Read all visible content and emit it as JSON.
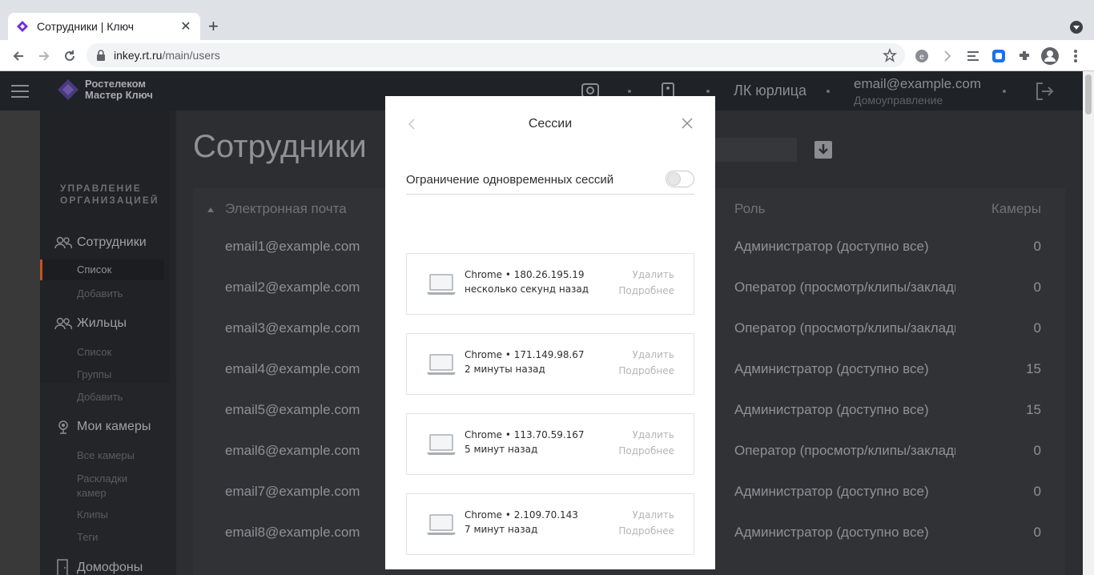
{
  "browser": {
    "tab_title": "Сотрудники | Ключ",
    "url_host": "inkey.rt.ru",
    "url_path": "/main/users"
  },
  "header": {
    "logo_line1": "Ростелеком",
    "logo_line2": "Мастер Ключ",
    "org_label": "ЛК юрлица",
    "user_email": "email@example.com",
    "user_sub": "Домоуправление"
  },
  "sidebar": {
    "section_title_1": "УПРАВЛЕНИЕ",
    "section_title_2": "ОРГАНИЗАЦИЕЙ",
    "employees": {
      "label": "Сотрудники",
      "list": "Список",
      "add": "Добавить"
    },
    "residents": {
      "label": "Жильцы",
      "list": "Список",
      "groups": "Группы",
      "add": "Добавить"
    },
    "cameras": {
      "label": "Мои камеры",
      "all": "Все камеры",
      "layouts_1": "Раскладки",
      "layouts_2": "камер",
      "clips": "Клипы",
      "tags": "Теги"
    },
    "intercoms": {
      "label": "Домофоны"
    }
  },
  "main": {
    "page_title": "Сотрудники",
    "columns": {
      "email": "Электронная почта",
      "role": "Роль",
      "cameras": "Камеры"
    },
    "rows": [
      {
        "email": "email1@example.com",
        "role": "Администратор (доступно все)",
        "cameras": "0"
      },
      {
        "email": "email2@example.com",
        "role": "Оператор (просмотр/клипы/закладки)",
        "cameras": "0"
      },
      {
        "email": "email3@example.com",
        "role": "Оператор (просмотр/клипы/закладки)",
        "cameras": "0"
      },
      {
        "email": "email4@example.com",
        "role": "Администратор (доступно все)",
        "cameras": "15"
      },
      {
        "email": "email5@example.com",
        "role": "Администратор (доступно все)",
        "cameras": "15"
      },
      {
        "email": "email6@example.com",
        "role": "Оператор (просмотр/клипы/закладки)",
        "cameras": "0"
      },
      {
        "email": "email7@example.com",
        "role": "Администратор (доступно все)",
        "cameras": "0"
      },
      {
        "email": "email8@example.com",
        "role": "Администратор (доступно все)",
        "cameras": "0"
      }
    ]
  },
  "modal": {
    "title": "Сессии",
    "limit_label": "Ограничение одновременных сессий",
    "limit_enabled": false,
    "delete_label": "Удалить",
    "details_label": "Подробнее",
    "sessions": [
      {
        "title": "Chrome • 180.26.195.19",
        "time": "несколько секунд назад"
      },
      {
        "title": "Chrome • 171.149.98.67",
        "time": "2 минуты назад"
      },
      {
        "title": "Chrome • 113.70.59.167",
        "time": "5 минут назад"
      },
      {
        "title": "Chrome • 2.109.70.143",
        "time": "7 минут назад"
      }
    ]
  },
  "colors": {
    "accent": "#c4531e",
    "overlay_dark": "#2c2e32",
    "modal_bg": "#ffffff"
  }
}
